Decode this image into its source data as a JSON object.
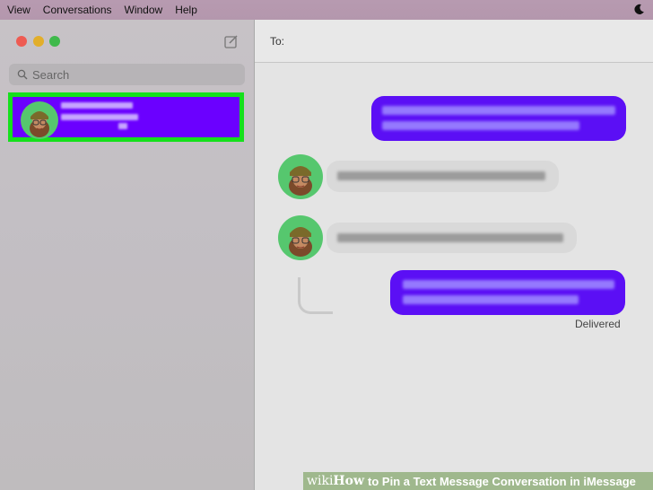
{
  "menubar": {
    "items": [
      "View",
      "Conversations",
      "Window",
      "Help"
    ]
  },
  "sidebar": {
    "search_placeholder": "Search"
  },
  "header": {
    "to_label": "To:"
  },
  "thread": {
    "status": "Delivered"
  },
  "colors": {
    "highlight_border": "#15e01c",
    "selected_bg": "#6b00ff",
    "outgoing_bubble": "#5b0ff5",
    "incoming_bubble": "#d9d9d9"
  },
  "icons": [
    "moon-icon",
    "compose-icon",
    "search-icon",
    "avatar-icon"
  ],
  "watermark": {
    "wiki_a": "wiki",
    "wiki_b": "How",
    "text": "to Pin a Text Message Conversation in iMessage"
  }
}
